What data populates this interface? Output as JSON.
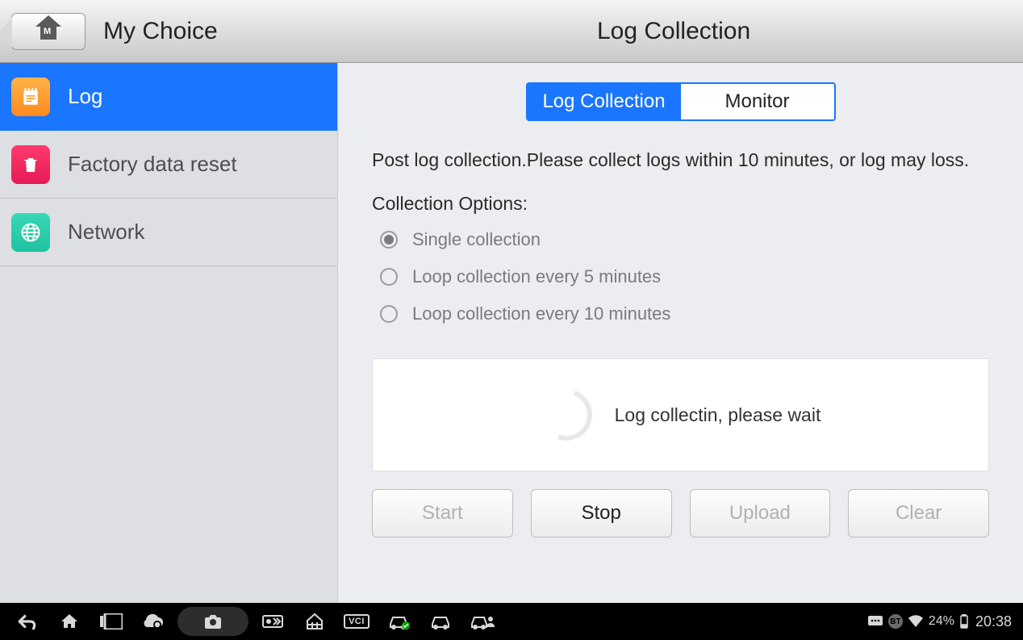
{
  "header": {
    "left_title": "My Choice",
    "right_title": "Log Collection"
  },
  "sidebar": {
    "items": [
      {
        "label": "Log",
        "icon": "notepad-icon",
        "active": true
      },
      {
        "label": "Factory data reset",
        "icon": "trash-icon",
        "active": false
      },
      {
        "label": "Network",
        "icon": "globe-icon",
        "active": false
      }
    ]
  },
  "tabs": {
    "items": [
      {
        "label": "Log Collection",
        "active": true
      },
      {
        "label": "Monitor",
        "active": false
      }
    ]
  },
  "description": "Post log collection.Please collect logs within 10 minutes, or log may loss.",
  "options": {
    "title": "Collection Options:",
    "items": [
      {
        "label": "Single collection",
        "selected": true
      },
      {
        "label": "Loop collection every 5 minutes",
        "selected": false
      },
      {
        "label": "Loop collection every 10 minutes",
        "selected": false
      }
    ]
  },
  "progress": {
    "text": "Log collectin, please wait"
  },
  "buttons": {
    "start": "Start",
    "stop": "Stop",
    "upload": "Upload",
    "clear": "Clear"
  },
  "sysbar": {
    "vci": "VCI",
    "battery_text": "24%",
    "time": "20:38"
  }
}
